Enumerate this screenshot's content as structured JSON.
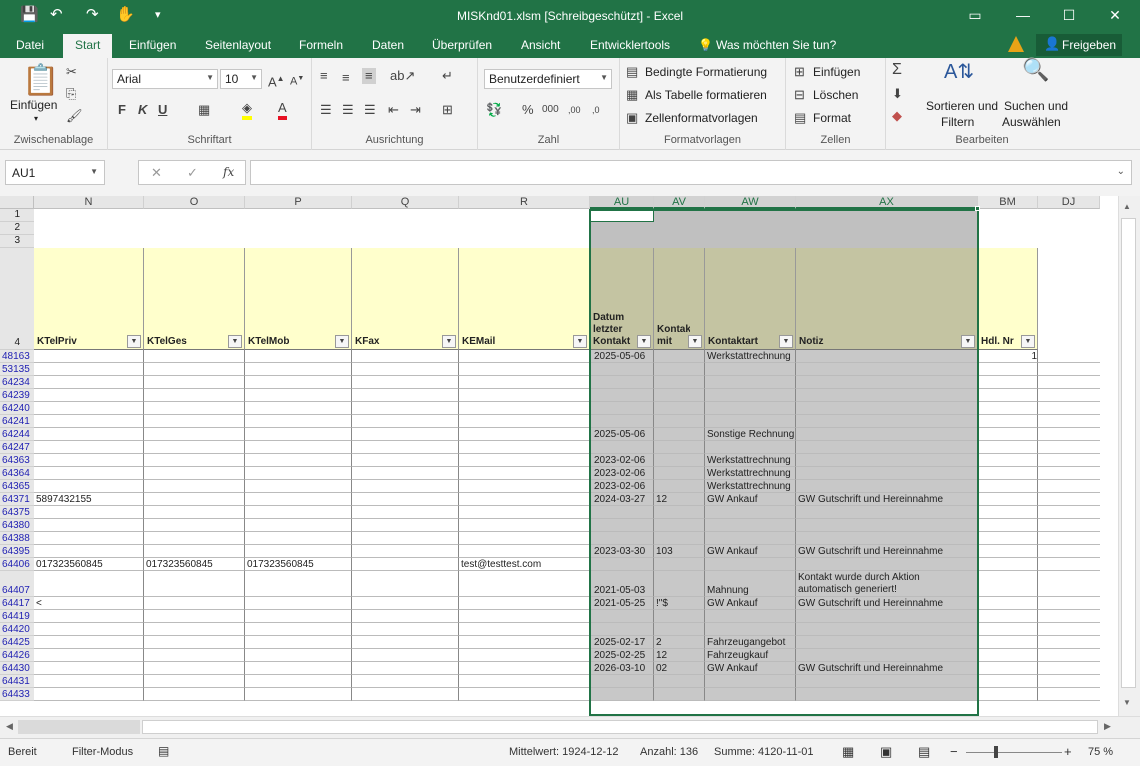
{
  "title": "MISKnd01.xlsm  [Schreibgeschützt] - Excel",
  "tabs": [
    "Datei",
    "Start",
    "Einfügen",
    "Seitenlayout",
    "Formeln",
    "Daten",
    "Überprüfen",
    "Ansicht",
    "Entwicklertools"
  ],
  "tell_me": "Was möchten Sie tun?",
  "share": "Freigeben",
  "ribbon": {
    "clipboard": {
      "paste": "Einfügen",
      "label": "Zwischenablage"
    },
    "font": {
      "name": "Arial",
      "size": "10",
      "bold": "F",
      "italic": "K",
      "underline": "U",
      "label": "Schriftart"
    },
    "alignment": {
      "label": "Ausrichtung"
    },
    "number": {
      "format": "Benutzerdefiniert",
      "label": "Zahl"
    },
    "styles": {
      "conditional": "Bedingte Formatierung",
      "table": "Als Tabelle formatieren",
      "cellstyles": "Zellenformatvorlagen",
      "label": "Formatvorlagen"
    },
    "cells": {
      "insert": "Einfügen",
      "delete": "Löschen",
      "format": "Format",
      "label": "Zellen"
    },
    "editing": {
      "sort1": "Sortieren und",
      "sort2": "Filtern",
      "find1": "Suchen und",
      "find2": "Auswählen",
      "label": "Bearbeiten"
    }
  },
  "namebox": "AU1",
  "columns": [
    "N",
    "O",
    "P",
    "Q",
    "R",
    "AU",
    "AV",
    "AW",
    "AX",
    "BM",
    "DJ"
  ],
  "header_rows": [
    "1",
    "2",
    "3",
    "4"
  ],
  "field_headers": [
    "KTelPriv",
    "KTelGes",
    "KTelMob",
    "KFax",
    "KEMail",
    "Datum letzter Kontakt",
    "Kontakt mit",
    "Kontaktart",
    "Notiz",
    "Hdl. Nr"
  ],
  "rows": [
    {
      "id": "48163",
      "au": "2025-05-06",
      "aw": "Werkstattrechnung",
      "bm": "1"
    },
    {
      "id": "53135"
    },
    {
      "id": "64234"
    },
    {
      "id": "64239"
    },
    {
      "id": "64240"
    },
    {
      "id": "64241"
    },
    {
      "id": "64244",
      "au": "2025-05-06",
      "aw": "Sonstige Rechnung"
    },
    {
      "id": "64247"
    },
    {
      "id": "64363",
      "au": "2023-02-06",
      "aw": "Werkstattrechnung"
    },
    {
      "id": "64364",
      "au": "2023-02-06",
      "aw": "Werkstattrechnung"
    },
    {
      "id": "64365",
      "au": "2023-02-06",
      "aw": "Werkstattrechnung"
    },
    {
      "id": "64371",
      "n": "5897432155",
      "au": "2024-03-27",
      "av": "12",
      "aw": "GW Ankauf",
      "ax": "GW Gutschrift und Hereinnahme"
    },
    {
      "id": "64375"
    },
    {
      "id": "64380"
    },
    {
      "id": "64388"
    },
    {
      "id": "64395",
      "au": "2023-03-30",
      "av": "103",
      "aw": "GW Ankauf",
      "ax": "GW Gutschrift und Hereinnahme"
    },
    {
      "id": "64406",
      "n": "017323560845",
      "o": "017323560845",
      "p": "017323560845",
      "r": "test@testtest.com"
    },
    {
      "id": "64407",
      "au": "2021-05-03",
      "aw": "Mahnung",
      "ax": "Kontakt wurde durch Aktion",
      "ax2": "automatisch generiert!",
      "tall": true
    },
    {
      "id": "64417",
      "n": "<",
      "au": "2021-05-25",
      "av": "!\"$",
      "aw": "GW Ankauf",
      "ax": "GW Gutschrift und Hereinnahme"
    },
    {
      "id": "64419"
    },
    {
      "id": "64420"
    },
    {
      "id": "64425",
      "au": "2025-02-17",
      "av": "2",
      "aw": "Fahrzeugangebot"
    },
    {
      "id": "64426",
      "au": "2025-02-25",
      "av": "12",
      "aw": "Fahrzeugkauf"
    },
    {
      "id": "64430",
      "au": "2026-03-10",
      "av": "02",
      "aw": "GW Ankauf",
      "ax": "GW Gutschrift und Hereinnahme"
    },
    {
      "id": "64431"
    },
    {
      "id": "64433"
    }
  ],
  "status": {
    "ready": "Bereit",
    "filter": "Filter-Modus",
    "avg": "Mittelwert: 1924-12-12",
    "count": "Anzahl: 136",
    "sum": "Summe: 4120-11-01",
    "zoom": "75 %"
  },
  "colors": {
    "green": "#217346",
    "yellow": "#ffffcc",
    "gray": "#c8c8c8",
    "olive": "#c4c4a2"
  }
}
